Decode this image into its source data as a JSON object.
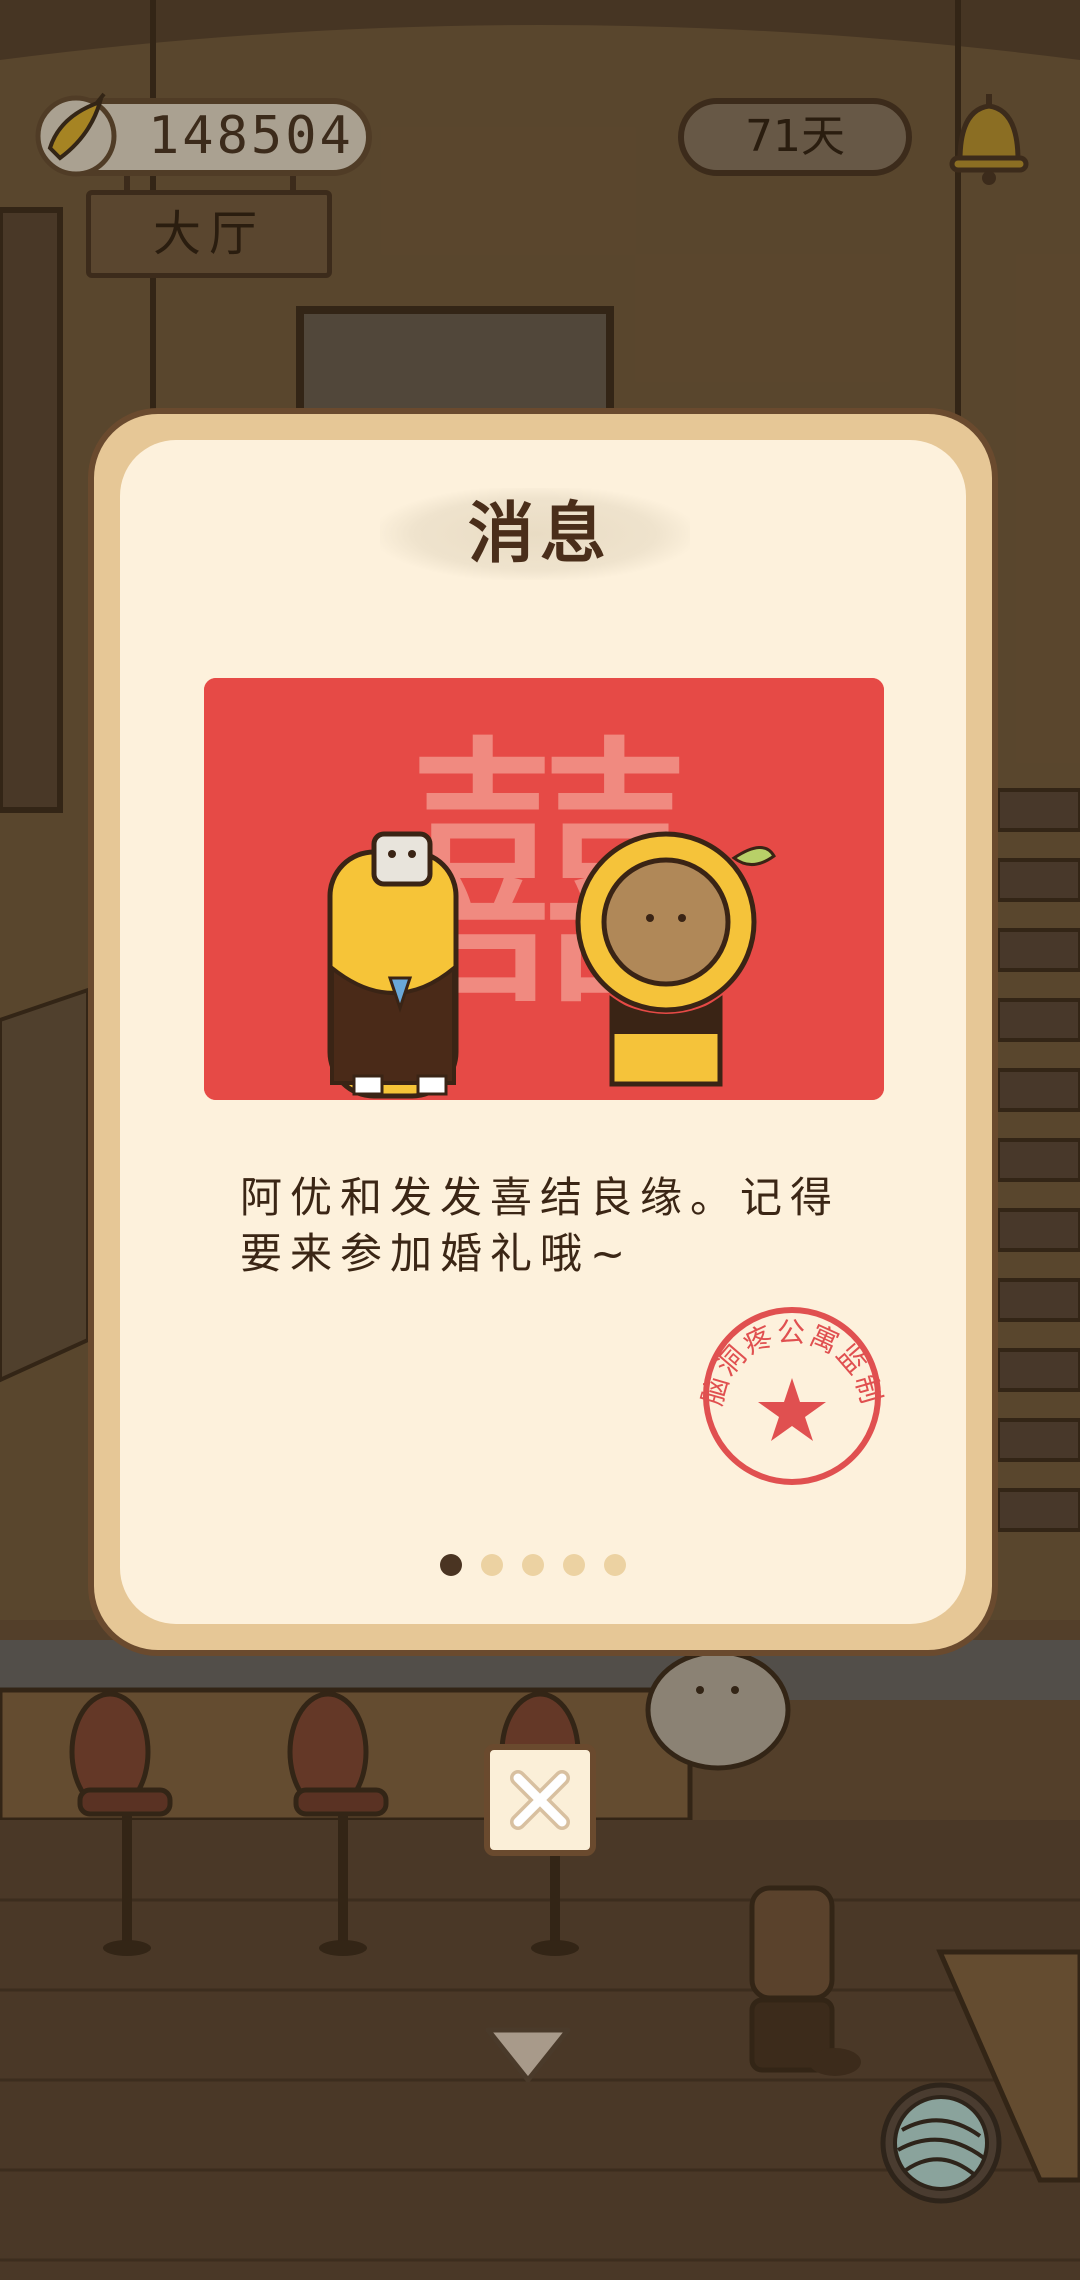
{
  "hud": {
    "coins": "148504",
    "coin_icon": "banana-icon",
    "room_sign": "大厅",
    "days": "71天",
    "bell_icon": "bell-icon"
  },
  "modal": {
    "title": "消息",
    "image_text": "囍",
    "message": "阿优和发发喜结良缘。记得要来参加婚礼哦~",
    "stamp_text": "脑洞疼公寓监制",
    "page_count": 5,
    "current_page": 1,
    "close_icon": "close-icon"
  },
  "nav": {
    "down_icon": "chevron-down-icon",
    "yarn_icon": "yarn-ball-icon"
  },
  "colors": {
    "card_red": "#e64a46",
    "panel_cream": "#fdf1dc",
    "panel_border": "#e6c796",
    "stamp_red": "#e05050"
  }
}
